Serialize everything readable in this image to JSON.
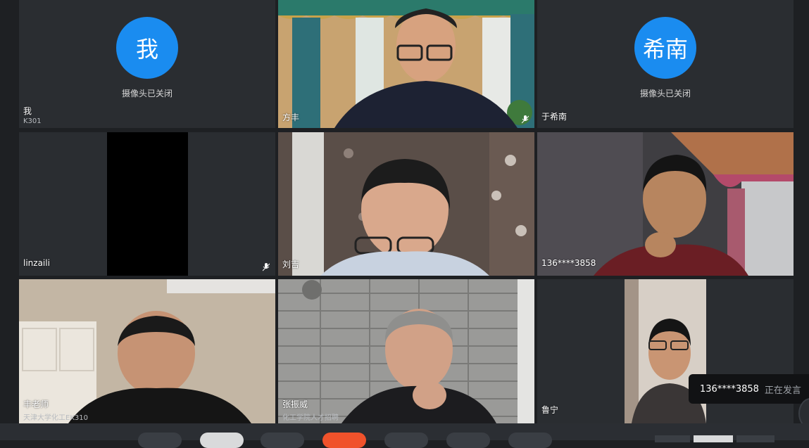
{
  "participants": [
    {
      "name": "我",
      "avatar_text": "我",
      "sub": "K301",
      "status": "摄像头已关闭"
    },
    {
      "name": "方丰"
    },
    {
      "name": "于希南",
      "avatar_text": "希南",
      "status": "摄像头已关闭"
    },
    {
      "name": "linzaili"
    },
    {
      "name": "刘吉"
    },
    {
      "name": "136****3858"
    },
    {
      "name": "丰老师",
      "sub": "天津大学化工EK310"
    },
    {
      "name": "张振威",
      "sub": "化工学院人才招聘"
    },
    {
      "name": "鲁宁"
    }
  ],
  "toast": {
    "number": "136****3858",
    "status": "正在发言"
  },
  "colors": {
    "avatar": "#1a8cf0",
    "speaking_border": "#2ecc71",
    "hangup": "#f0522b"
  }
}
